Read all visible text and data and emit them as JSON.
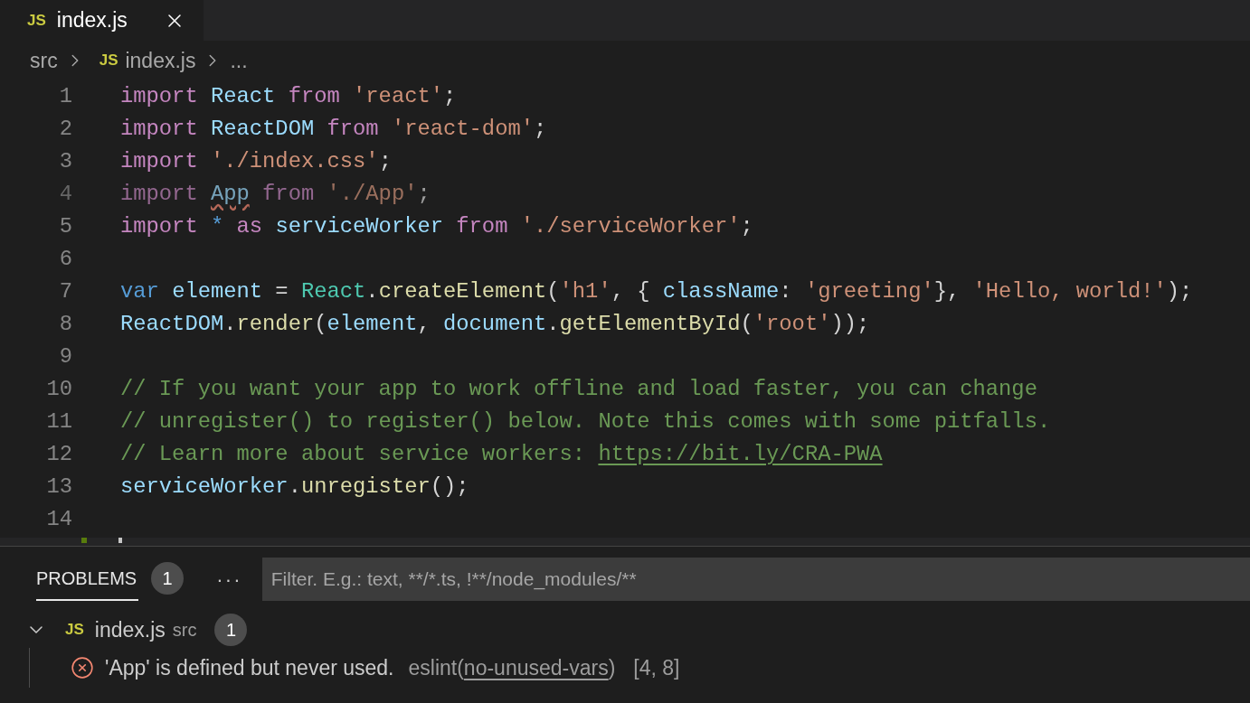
{
  "tabs": [
    {
      "icon_label": "JS",
      "label": "index.js",
      "selected": true
    }
  ],
  "breadcrumb": [
    {
      "kind": "folder",
      "label": "src"
    },
    {
      "kind": "file",
      "icon_label": "JS",
      "label": "index.js"
    },
    {
      "kind": "more",
      "label": "..."
    }
  ],
  "editor": {
    "lines": [
      {
        "number": "1",
        "faded": false,
        "tokens": [
          {
            "text": "import ",
            "kind": "keyword"
          },
          {
            "text": "React ",
            "kind": "variable"
          },
          {
            "text": "from ",
            "kind": "keyword"
          },
          {
            "text": "'react'",
            "kind": "string"
          },
          {
            "text": ";",
            "kind": "plain"
          }
        ]
      },
      {
        "number": "2",
        "faded": false,
        "tokens": [
          {
            "text": "import ",
            "kind": "keyword"
          },
          {
            "text": "ReactDOM ",
            "kind": "variable"
          },
          {
            "text": "from ",
            "kind": "keyword"
          },
          {
            "text": "'react-dom'",
            "kind": "string"
          },
          {
            "text": ";",
            "kind": "plain"
          }
        ]
      },
      {
        "number": "3",
        "faded": false,
        "tokens": [
          {
            "text": "import ",
            "kind": "keyword"
          },
          {
            "text": "'./index.css'",
            "kind": "string"
          },
          {
            "text": ";",
            "kind": "plain"
          }
        ]
      },
      {
        "number": "4",
        "faded": true,
        "tokens": [
          {
            "text": "import ",
            "kind": "keyword"
          },
          {
            "text": "App",
            "kind": "variable_error"
          },
          {
            "text": " from ",
            "kind": "keyword"
          },
          {
            "text": "'./App'",
            "kind": "string"
          },
          {
            "text": ";",
            "kind": "plain"
          }
        ]
      },
      {
        "number": "5",
        "faded": false,
        "tokens": [
          {
            "text": "import ",
            "kind": "keyword"
          },
          {
            "text": "* ",
            "kind": "storage"
          },
          {
            "text": "as ",
            "kind": "keyword"
          },
          {
            "text": "serviceWorker ",
            "kind": "variable"
          },
          {
            "text": "from ",
            "kind": "keyword"
          },
          {
            "text": "'./serviceWorker'",
            "kind": "string"
          },
          {
            "text": ";",
            "kind": "plain"
          }
        ]
      },
      {
        "number": "6",
        "faded": false
      },
      {
        "number": "7",
        "faded": false,
        "tokens": [
          {
            "text": "var ",
            "kind": "storage"
          },
          {
            "text": "element",
            "kind": "variable"
          },
          {
            "text": " = ",
            "kind": "plain"
          },
          {
            "text": "React",
            "kind": "class"
          },
          {
            "text": ".",
            "kind": "plain"
          },
          {
            "text": "createElement",
            "kind": "function"
          },
          {
            "text": "(",
            "kind": "plain"
          },
          {
            "text": "'h1'",
            "kind": "string"
          },
          {
            "text": ", { ",
            "kind": "plain"
          },
          {
            "text": "className",
            "kind": "variable"
          },
          {
            "text": ": ",
            "kind": "plain"
          },
          {
            "text": "'greeting'",
            "kind": "string"
          },
          {
            "text": "}, ",
            "kind": "plain"
          },
          {
            "text": "'Hello, world!'",
            "kind": "string"
          },
          {
            "text": ");",
            "kind": "plain"
          }
        ]
      },
      {
        "number": "8",
        "faded": false,
        "tokens": [
          {
            "text": "ReactDOM",
            "kind": "variable"
          },
          {
            "text": ".",
            "kind": "plain"
          },
          {
            "text": "render",
            "kind": "function"
          },
          {
            "text": "(",
            "kind": "plain"
          },
          {
            "text": "element",
            "kind": "variable"
          },
          {
            "text": ", ",
            "kind": "plain"
          },
          {
            "text": "document",
            "kind": "variable"
          },
          {
            "text": ".",
            "kind": "plain"
          },
          {
            "text": "getElementById",
            "kind": "function"
          },
          {
            "text": "(",
            "kind": "plain"
          },
          {
            "text": "'root'",
            "kind": "string"
          },
          {
            "text": "));",
            "kind": "plain"
          }
        ]
      },
      {
        "number": "9",
        "faded": false
      },
      {
        "number": "10",
        "faded": false,
        "tokens": [
          {
            "text": "// If you want your app to work offline and load faster, you can change",
            "kind": "comment"
          }
        ]
      },
      {
        "number": "11",
        "faded": false,
        "tokens": [
          {
            "text": "// unregister() to register() below. Note this comes with some pitfalls.",
            "kind": "comment"
          }
        ]
      },
      {
        "number": "12",
        "faded": false,
        "tokens": [
          {
            "text": "// Learn more about service workers: ",
            "kind": "comment"
          },
          {
            "text": "https://bit.ly/CRA-PWA",
            "kind": "link"
          }
        ]
      },
      {
        "number": "13",
        "faded": false,
        "tokens": [
          {
            "text": "serviceWorker",
            "kind": "variable"
          },
          {
            "text": ".",
            "kind": "plain"
          },
          {
            "text": "unregister",
            "kind": "function"
          },
          {
            "text": "();",
            "kind": "plain"
          }
        ]
      },
      {
        "number": "14",
        "faded": false
      }
    ]
  },
  "panel": {
    "tabs": [
      {
        "label": "PROBLEMS",
        "badge": "1",
        "selected": true
      }
    ],
    "more": "···",
    "filter": {
      "placeholder": "Filter. E.g.: text, **/*.ts, !**/node_modules/**"
    },
    "groups": [
      {
        "icon_label": "JS",
        "file": "index.js",
        "folder": "src",
        "count": "1",
        "expanded": true,
        "problems": [
          {
            "kind": "error",
            "message": "'App' is defined but never used.",
            "source_prefix": "eslint(",
            "code": "no-unused-vars",
            "source_suffix": ")",
            "position": "[4, 8]"
          }
        ]
      }
    ]
  }
}
